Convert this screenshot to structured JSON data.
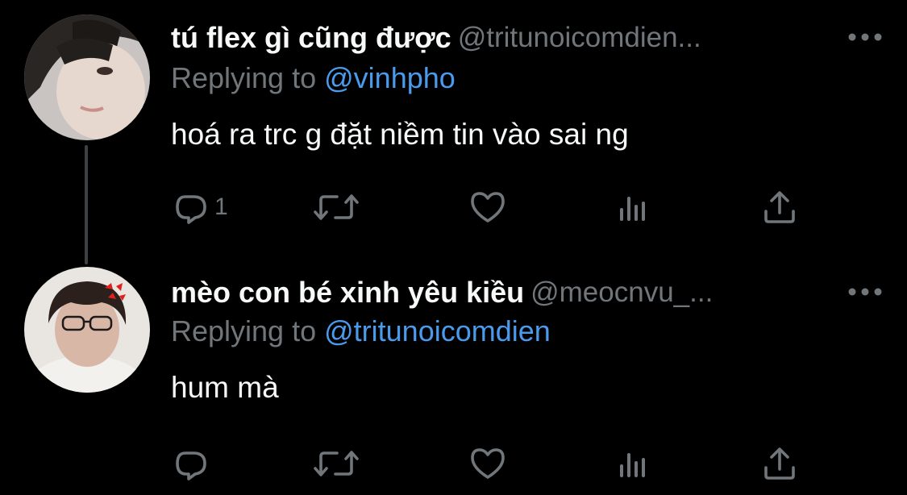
{
  "tweets": [
    {
      "display_name": "tú flex gì cũng được",
      "handle": "@tritunoicomdien...",
      "reply_label": "Replying to",
      "reply_to": "@vinhpho",
      "text": "hoá ra trc g đặt niềm tin vào sai ng",
      "reply_count": "1",
      "avatar_icon": "avatar-photo",
      "more_icon": "more-horizontal-icon"
    },
    {
      "display_name": "mèo con bé xinh yêu kiều",
      "handle": "@meocnvu_...",
      "reply_label": "Replying to",
      "reply_to": "@tritunoicomdien",
      "text": "hum mà",
      "reply_count": "",
      "avatar_icon": "avatar-photo",
      "more_icon": "more-horizontal-icon"
    }
  ],
  "colors": {
    "background": "#000000",
    "text_primary": "#f7f9f9",
    "text_secondary": "#71767b",
    "link": "#4a9bec",
    "thread_line": "#3e4144"
  },
  "icons": {
    "reply": "reply-icon",
    "retweet": "retweet-icon",
    "like": "heart-icon",
    "views": "views-bar-chart-icon",
    "share": "share-icon"
  }
}
